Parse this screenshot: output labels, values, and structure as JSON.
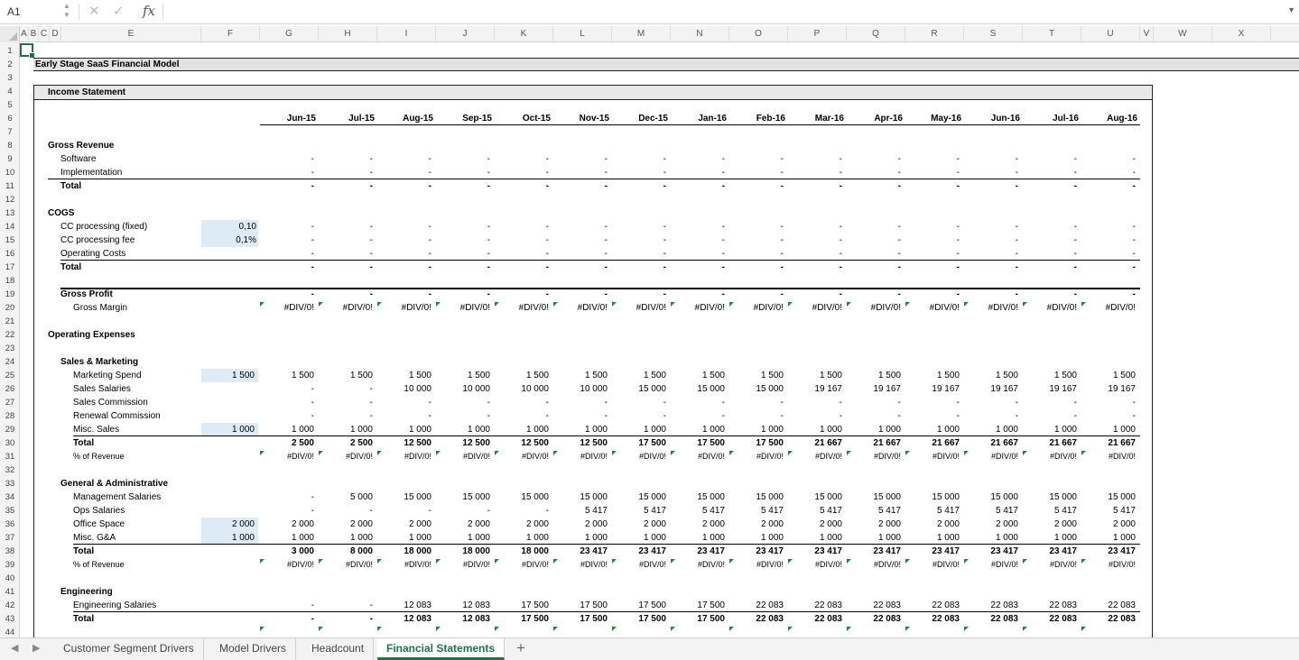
{
  "formula_bar": {
    "cell_ref": "A1",
    "fx": "fx",
    "cancel": "✕",
    "confirm": "✓"
  },
  "columns": [
    "A",
    "B",
    "C",
    "D",
    "E",
    "F",
    "G",
    "H",
    "I",
    "J",
    "K",
    "L",
    "M",
    "N",
    "O",
    "P",
    "Q",
    "R",
    "S",
    "T",
    "U",
    "V",
    "W",
    "X"
  ],
  "sheet": {
    "title": "Early Stage SaaS Financial Model",
    "section": "Income Statement",
    "months": [
      "Jun-15",
      "Jul-15",
      "Aug-15",
      "Sep-15",
      "Oct-15",
      "Nov-15",
      "Dec-15",
      "Jan-16",
      "Feb-16",
      "Mar-16",
      "Apr-16",
      "May-16",
      "Jun-16",
      "Jul-16",
      "Aug-16"
    ],
    "dash": "-",
    "div0": "#DIV/0!",
    "gross_revenue": {
      "label": "Gross Revenue",
      "software": "Software",
      "implementation": "Implementation",
      "total": "Total"
    },
    "cogs": {
      "label": "COGS",
      "cc_fixed": "CC processing (fixed)",
      "cc_fixed_input": "0,10",
      "cc_fee": "CC processing fee",
      "cc_fee_input": "0,1%",
      "op_costs": "Operating Costs",
      "total": "Total"
    },
    "gross_profit": {
      "label": "Gross Profit",
      "margin": "Gross Margin"
    },
    "opex": {
      "label": "Operating Expenses"
    },
    "sm": {
      "label": "Sales & Marketing",
      "marketing": "Marketing Spend",
      "marketing_input": "1 500",
      "salaries": "Sales Salaries",
      "commission": "Sales Commission",
      "renewal": "Renewal Commission",
      "misc": "Misc. Sales",
      "misc_input": "1 000",
      "total": "Total",
      "pct": "% of Revenue",
      "marketing_vals": [
        "1 500",
        "1 500",
        "1 500",
        "1 500",
        "1 500",
        "1 500",
        "1 500",
        "1 500",
        "1 500",
        "1 500",
        "1 500",
        "1 500",
        "1 500",
        "1 500",
        "1 500"
      ],
      "salaries_vals": [
        "-",
        "-",
        "10 000",
        "10 000",
        "10 000",
        "10 000",
        "15 000",
        "15 000",
        "15 000",
        "19 167",
        "19 167",
        "19 167",
        "19 167",
        "19 167",
        "19 167"
      ],
      "misc_vals": [
        "1 000",
        "1 000",
        "1 000",
        "1 000",
        "1 000",
        "1 000",
        "1 000",
        "1 000",
        "1 000",
        "1 000",
        "1 000",
        "1 000",
        "1 000",
        "1 000",
        "1 000"
      ],
      "total_vals": [
        "2 500",
        "2 500",
        "12 500",
        "12 500",
        "12 500",
        "12 500",
        "17 500",
        "17 500",
        "17 500",
        "21 667",
        "21 667",
        "21 667",
        "21 667",
        "21 667",
        "21 667"
      ]
    },
    "ga": {
      "label": "General & Administrative",
      "mgmt": "Management Salaries",
      "ops": "Ops Salaries",
      "office": "Office Space",
      "office_input": "2 000",
      "misc": "Misc. G&A",
      "misc_input": "1 000",
      "total": "Total",
      "pct": "% of Revenue",
      "mgmt_vals": [
        "-",
        "5 000",
        "15 000",
        "15 000",
        "15 000",
        "15 000",
        "15 000",
        "15 000",
        "15 000",
        "15 000",
        "15 000",
        "15 000",
        "15 000",
        "15 000",
        "15 000"
      ],
      "ops_vals": [
        "-",
        "-",
        "-",
        "-",
        "-",
        "5 417",
        "5 417",
        "5 417",
        "5 417",
        "5 417",
        "5 417",
        "5 417",
        "5 417",
        "5 417",
        "5 417"
      ],
      "office_vals": [
        "2 000",
        "2 000",
        "2 000",
        "2 000",
        "2 000",
        "2 000",
        "2 000",
        "2 000",
        "2 000",
        "2 000",
        "2 000",
        "2 000",
        "2 000",
        "2 000",
        "2 000"
      ],
      "misc_vals": [
        "1 000",
        "1 000",
        "1 000",
        "1 000",
        "1 000",
        "1 000",
        "1 000",
        "1 000",
        "1 000",
        "1 000",
        "1 000",
        "1 000",
        "1 000",
        "1 000",
        "1 000"
      ],
      "total_vals": [
        "3 000",
        "8 000",
        "18 000",
        "18 000",
        "18 000",
        "23 417",
        "23 417",
        "23 417",
        "23 417",
        "23 417",
        "23 417",
        "23 417",
        "23 417",
        "23 417",
        "23 417"
      ]
    },
    "eng": {
      "label": "Engineering",
      "salaries": "Engineering Salaries",
      "total": "Total",
      "salaries_vals": [
        "-",
        "-",
        "12 083",
        "12 083",
        "17 500",
        "17 500",
        "17 500",
        "17 500",
        "22 083",
        "22 083",
        "22 083",
        "22 083",
        "22 083",
        "22 083",
        "22 083"
      ],
      "total_vals": [
        "-",
        "-",
        "12 083",
        "12 083",
        "17 500",
        "17 500",
        "17 500",
        "17 500",
        "22 083",
        "22 083",
        "22 083",
        "22 083",
        "22 083",
        "22 083",
        "22 083"
      ]
    }
  },
  "tabs": [
    "Customer Segment Drivers",
    "Model Drivers",
    "Headcount",
    "Financial Statements"
  ],
  "active_tab": "Financial Statements",
  "add_tab": "+",
  "accent_color": "#217346"
}
